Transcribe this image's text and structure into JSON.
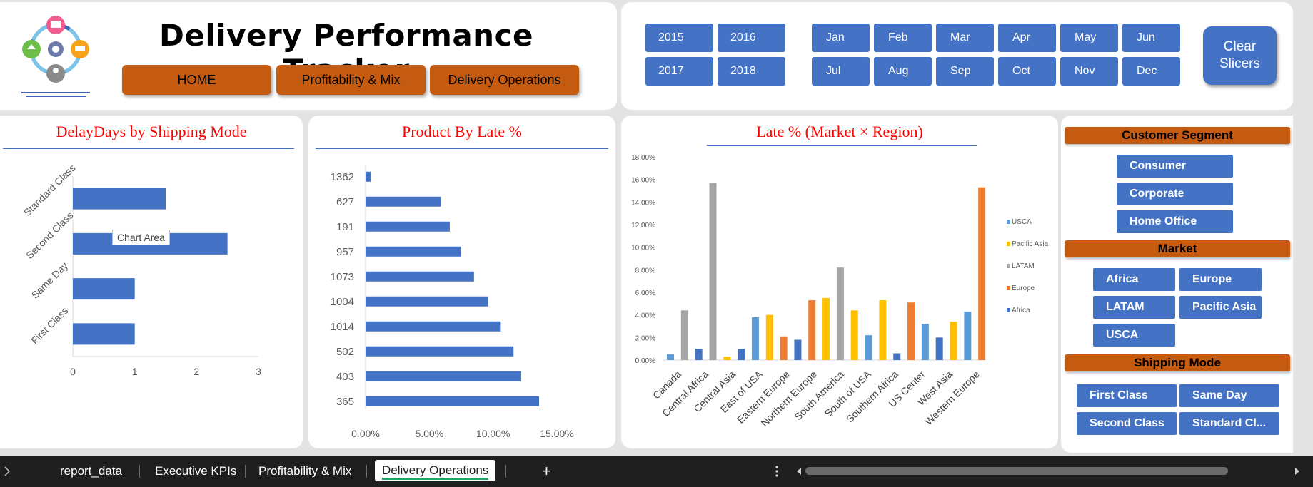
{
  "header": {
    "title": "Delivery Performance Tracker",
    "nav": [
      "HOME",
      "Profitability & Mix",
      "Delivery Operations"
    ]
  },
  "slicers": {
    "years": [
      "2015",
      "2016",
      "2017",
      "2018"
    ],
    "months": [
      "Jan",
      "Feb",
      "Mar",
      "Apr",
      "May",
      "Jun",
      "Jul",
      "Aug",
      "Sep",
      "Oct",
      "Nov",
      "Dec"
    ],
    "clear_label": "Clear Slicers"
  },
  "side": {
    "customer_segment": {
      "title": "Customer Segment",
      "items": [
        "Consumer",
        "Corporate",
        "Home Office"
      ]
    },
    "market": {
      "title": "Market",
      "items": [
        "Africa",
        "Europe",
        "LATAM",
        "Pacific Asia",
        "USCA"
      ]
    },
    "shipping_mode": {
      "title": "Shipping Mode",
      "items": [
        "First Class",
        "Same Day",
        "Second Class",
        "Standard Cl..."
      ]
    }
  },
  "tooltip": "Chart Area",
  "sheet_tabs": [
    "report_data",
    "Executive KPIs",
    "Profitability & Mix",
    "Delivery Operations"
  ],
  "add_sheet": "+",
  "colors": {
    "accent": "#c55a11",
    "bar": "#4472c4",
    "title_red": "#ff0000"
  },
  "chart_data": [
    {
      "type": "bar",
      "orientation": "horizontal",
      "title": "DelayDays by Shipping Mode",
      "categories": [
        "Standard Class",
        "Second Class",
        "Same Day",
        "First Class"
      ],
      "values": [
        1.5,
        2.5,
        1.0,
        1.0
      ],
      "xlim": [
        0,
        3
      ],
      "xticks": [
        "0",
        "1",
        "2",
        "3"
      ]
    },
    {
      "type": "bar",
      "orientation": "horizontal",
      "title": "Product By Late %",
      "categories": [
        "1362",
        "627",
        "191",
        "957",
        "1073",
        "1004",
        "1014",
        "502",
        "403",
        "365"
      ],
      "values": [
        0.4,
        5.9,
        6.6,
        7.5,
        8.5,
        9.6,
        10.6,
        11.6,
        12.2,
        13.6
      ],
      "xlim": [
        0,
        15
      ],
      "xticks": [
        "0.00%",
        "5.00%",
        "10.00%",
        "15.00%"
      ]
    },
    {
      "type": "bar",
      "title": "Late % (Market × Region)",
      "categories": [
        "Canada",
        "Central Africa",
        "Central Asia",
        "East of USA",
        "Eastern Europe",
        "Northern Europe",
        "South America",
        "South of USA",
        "Southern Africa",
        "US Center",
        "West Asia",
        "Western Europe"
      ],
      "ylim": [
        0,
        18
      ],
      "yticks": [
        "0.00%",
        "2.00%",
        "4.00%",
        "6.00%",
        "8.00%",
        "10.00%",
        "12.00%",
        "14.00%",
        "16.00%",
        "18.00%"
      ],
      "legend": [
        "USCA",
        "Pacific Asia",
        "LATAM",
        "Europe",
        "Africa"
      ],
      "legend_position": "right",
      "series_colors": {
        "Africa": "#4472c4",
        "Europe": "#ed7d31",
        "LATAM": "#a5a5a5",
        "Pacific Asia": "#ffc000",
        "USCA": "#5b9bd5"
      },
      "bars": [
        {
          "series": "USCA",
          "value": 0.5
        },
        {
          "series": "LATAM",
          "value": 4.4
        },
        {
          "series": "Africa",
          "value": 1.0
        },
        {
          "series": "LATAM",
          "value": 15.7
        },
        {
          "series": "Pacific Asia",
          "value": 0.3
        },
        {
          "series": "Africa",
          "value": 1.0
        },
        {
          "series": "USCA",
          "value": 3.8
        },
        {
          "series": "Pacific Asia",
          "value": 4.0
        },
        {
          "series": "Europe",
          "value": 2.1
        },
        {
          "series": "Africa",
          "value": 1.8
        },
        {
          "series": "Europe",
          "value": 5.3
        },
        {
          "series": "Pacific Asia",
          "value": 5.5
        },
        {
          "series": "LATAM",
          "value": 8.2
        },
        {
          "series": "Pacific Asia",
          "value": 4.4
        },
        {
          "series": "USCA",
          "value": 2.2
        },
        {
          "series": "Pacific Asia",
          "value": 5.3
        },
        {
          "series": "Africa",
          "value": 0.6
        },
        {
          "series": "Europe",
          "value": 5.1
        },
        {
          "series": "USCA",
          "value": 3.2
        },
        {
          "series": "Africa",
          "value": 2.0
        },
        {
          "series": "Pacific Asia",
          "value": 3.4
        },
        {
          "series": "USCA",
          "value": 4.3
        },
        {
          "series": "Europe",
          "value": 15.3
        }
      ]
    }
  ]
}
